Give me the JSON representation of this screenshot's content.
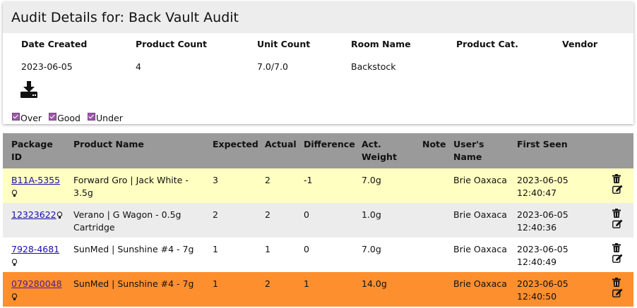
{
  "header": {
    "title": "Audit Details for: Back Vault Audit"
  },
  "summary": {
    "labels": [
      "Date Created",
      "Product Count",
      "Unit Count",
      "Room Name",
      "Product Cat.",
      "Vendor"
    ],
    "values": [
      "2023-06-05",
      "4",
      "7.0/7.0",
      "Backstock",
      "",
      ""
    ]
  },
  "filters": [
    {
      "label": "Over",
      "checked": true
    },
    {
      "label": "Good",
      "checked": true
    },
    {
      "label": "Under",
      "checked": true
    }
  ],
  "table": {
    "headers": [
      "Package ID",
      "Product Name",
      "Expected",
      "Actual",
      "Difference",
      "Act. Weight",
      "Note",
      "User's Name",
      "First Seen",
      ""
    ],
    "rows": [
      {
        "package_id": "B11A-5355",
        "product": "Forward Gro | Jack White - 3.5g",
        "expected": "3",
        "actual": "2",
        "difference": "-1",
        "weight": "7.0g",
        "note": "",
        "user": "Brie Oaxaca",
        "first_seen_date": "2023-06-05",
        "first_seen_time": "12:40:47",
        "status": "under",
        "color": "#ffffc2"
      },
      {
        "package_id": "12323622",
        "product": "Verano | G Wagon - 0.5g Cartridge",
        "expected": "2",
        "actual": "2",
        "difference": "0",
        "weight": "1.0g",
        "note": "",
        "user": "Brie Oaxaca",
        "first_seen_date": "2023-06-05",
        "first_seen_time": "12:40:36",
        "status": "good",
        "color": "#ececec"
      },
      {
        "package_id": "7928-4681",
        "product": "SunMed | Sunshine #4 - 7g",
        "expected": "1",
        "actual": "1",
        "difference": "0",
        "weight": "7.0g",
        "note": "",
        "user": "Brie Oaxaca",
        "first_seen_date": "2023-06-05",
        "first_seen_time": "12:40:49",
        "status": "good",
        "color": "#ffffff"
      },
      {
        "package_id": "079280048",
        "product": "SunMed | Sunshine #4 - 7g",
        "expected": "1",
        "actual": "2",
        "difference": "1",
        "weight": "14.0g",
        "note": "",
        "user": "Brie Oaxaca",
        "first_seen_date": "2023-06-05",
        "first_seen_time": "12:40:50",
        "status": "over",
        "color": "#fd8f2e"
      }
    ]
  },
  "icons": {
    "download": "download-icon",
    "bulb": "lightbulb-icon",
    "delete": "trash-icon",
    "edit": "edit-icon"
  }
}
